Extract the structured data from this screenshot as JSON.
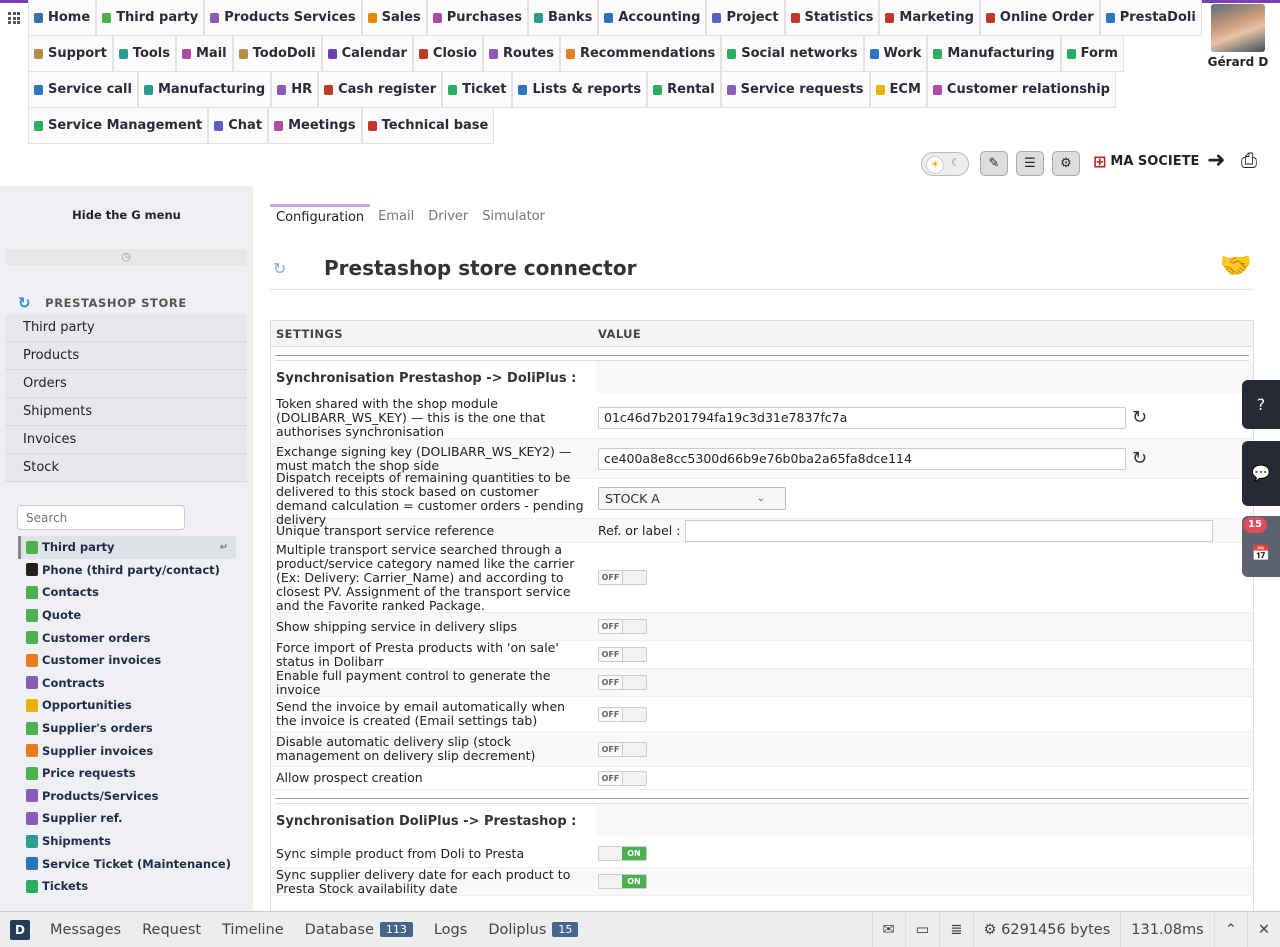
{
  "menu": {
    "rows": [
      [
        {
          "label": "Home",
          "icon": "home-icon",
          "color": "#3a6ea5"
        },
        {
          "label": "Third party",
          "icon": "building-icon",
          "color": "#4caf50"
        },
        {
          "label": "Products Services",
          "icon": "cubes-icon",
          "color": "#8a5cb8"
        },
        {
          "label": "Sales",
          "icon": "euro-icon",
          "color": "#e68a00"
        },
        {
          "label": "Purchases",
          "icon": "cart-icon",
          "color": "#b04ca8"
        },
        {
          "label": "Banks",
          "icon": "bank-icon",
          "color": "#2a9d8f"
        },
        {
          "label": "Accounting",
          "icon": "scale-icon",
          "color": "#2a75bb"
        },
        {
          "label": "Project",
          "icon": "sitemap-icon",
          "color": "#5b5fc7"
        },
        {
          "label": "Statistics",
          "icon": "chart-icon",
          "color": "#c0392b"
        },
        {
          "label": "Marketing",
          "icon": "megaphone-icon",
          "color": "#c0392b"
        },
        {
          "label": "Online Order",
          "icon": "globe-icon",
          "color": "#c0392b"
        },
        {
          "label": "PrestaDoli",
          "icon": "sync-icon",
          "color": "#2a75bb"
        }
      ],
      [
        {
          "label": "Support",
          "icon": "briefcase-icon",
          "color": "#b98b4a"
        },
        {
          "label": "Tools",
          "icon": "tools-icon",
          "color": "#2a9d8f"
        },
        {
          "label": "Mail",
          "icon": "mail-icon",
          "color": "#b04ca8"
        },
        {
          "label": "TodoDoli",
          "icon": "todo-icon",
          "color": "#b98b4a"
        },
        {
          "label": "Calendar",
          "icon": "calendar-icon",
          "color": "#6c3fb5"
        },
        {
          "label": "Closio",
          "icon": "closio-icon",
          "color": "#c0392b"
        },
        {
          "label": "Routes",
          "icon": "route-icon",
          "color": "#8a5cb8"
        },
        {
          "label": "Recommendations",
          "icon": "megaphone-icon",
          "color": "#e67e22"
        },
        {
          "label": "Social networks",
          "icon": "antenna-icon",
          "color": "#27ae60"
        },
        {
          "label": "Work",
          "icon": "road-icon",
          "color": "#2a75bb"
        },
        {
          "label": "Manufacturing",
          "icon": "chart-icon",
          "color": "#27ae60"
        },
        {
          "label": "Form",
          "icon": "form-icon",
          "color": "#27ae60"
        }
      ],
      [
        {
          "label": "Service call",
          "icon": "pen-icon",
          "color": "#2a75bb"
        },
        {
          "label": "Manufacturing",
          "icon": "cylinder-icon",
          "color": "#2a9d8f"
        },
        {
          "label": "HR",
          "icon": "users-icon",
          "color": "#8a5cb8"
        },
        {
          "label": "Cash register",
          "icon": "register-icon",
          "color": "#c0392b"
        },
        {
          "label": "Ticket",
          "icon": "headset-icon",
          "color": "#27ae60"
        },
        {
          "label": "Lists & reports",
          "icon": "table-icon",
          "color": "#2a75bb"
        },
        {
          "label": "Rental",
          "icon": "truck-icon",
          "color": "#27ae60"
        },
        {
          "label": "Service requests",
          "icon": "file-icon",
          "color": "#8a5cb8"
        },
        {
          "label": "ECM",
          "icon": "folder-icon",
          "color": "#e6b400"
        },
        {
          "label": "Customer relationship",
          "icon": "handshake-icon",
          "color": "#b04ca8"
        }
      ],
      [
        {
          "label": "Service Management",
          "icon": "handshake-icon",
          "color": "#27ae60"
        },
        {
          "label": "Chat",
          "icon": "chat-icon",
          "color": "#5b5fc7"
        },
        {
          "label": "Meetings",
          "icon": "video-icon",
          "color": "#b04ca8"
        },
        {
          "label": "Technical base",
          "icon": "book-icon",
          "color": "#c0392b"
        }
      ]
    ]
  },
  "user": {
    "name": "Gérard D"
  },
  "toolbar": {
    "company": "MA SOCIETE"
  },
  "left": {
    "hide_g_menu": "Hide the G menu",
    "loader": "◷",
    "ps_title": "PRESTASHOP STORE",
    "ps_items": [
      "Third party",
      "Products",
      "Orders",
      "Shipments",
      "Invoices",
      "Stock"
    ],
    "search_placeholder": "Search",
    "g_items": [
      {
        "label": "Third party",
        "icon": "building-icon",
        "color": "#4caf50",
        "active": true
      },
      {
        "label": "Phone (third party/contact)",
        "icon": "phone-icon",
        "color": "#222"
      },
      {
        "label": "Contacts",
        "icon": "users-icon",
        "color": "#4caf50"
      },
      {
        "label": "Quote",
        "icon": "quote-icon",
        "color": "#4caf50"
      },
      {
        "label": "Customer orders",
        "icon": "order-icon",
        "color": "#4caf50"
      },
      {
        "label": "Customer invoices",
        "icon": "euro-icon",
        "color": "#e67e22"
      },
      {
        "label": "Contracts",
        "icon": "contract-icon",
        "color": "#8a5cb8"
      },
      {
        "label": "Opportunities",
        "icon": "opportunity-icon",
        "color": "#e6b400"
      },
      {
        "label": "Supplier's orders",
        "icon": "order-icon",
        "color": "#4caf50"
      },
      {
        "label": "Supplier invoices",
        "icon": "euro-icon",
        "color": "#e67e22"
      },
      {
        "label": "Price requests",
        "icon": "quote-icon",
        "color": "#4caf50"
      },
      {
        "label": "Products/Services",
        "icon": "cubes-icon",
        "color": "#8a5cb8"
      },
      {
        "label": "Supplier ref.",
        "icon": "cubes-icon",
        "color": "#8a5cb8"
      },
      {
        "label": "Shipments",
        "icon": "truck-icon",
        "color": "#2a9d8f"
      },
      {
        "label": "Service Ticket (Maintenance)",
        "icon": "pen-icon",
        "color": "#2a75bb"
      },
      {
        "label": "Tickets",
        "icon": "headset-icon",
        "color": "#27ae60"
      }
    ]
  },
  "content": {
    "tabs": [
      "Configuration",
      "Email",
      "Driver",
      "Simulator"
    ],
    "title": "Prestashop store connector",
    "table_headers": {
      "settings": "SETTINGS",
      "value": "VALUE"
    },
    "section1": "Synchronisation Prestashop -> DoliPlus :",
    "section2": "Synchronisation DoliPlus -> Prestashop :",
    "rows": [
      {
        "label": "Token shared with the shop module (DOLIBARR_WS_KEY) — this is the one that authorises synchronisation",
        "type": "text",
        "value": "01c46d7b201794fa19c3d31e7837fc7a"
      },
      {
        "label": "Exchange signing key (DOLIBARR_WS_KEY2) — must match the shop side",
        "type": "text",
        "value": "ce400a8e8cc5300d66b9e76b0ba2a65fa8dce114"
      },
      {
        "label": "Dispatch receipts of remaining quantities to be delivered to this stock based on customer demand calculation = customer orders - pending delivery",
        "type": "select",
        "value": "STOCK A"
      },
      {
        "label": "Unique transport service reference",
        "type": "ref",
        "prefix": "Ref. or label :"
      },
      {
        "label": "Multiple transport service searched through a product/service category named like the carrier (Ex: Delivery: Carrier_Name) and according to closest PV. Assignment of the transport service and the Favorite ranked Package.",
        "type": "switch",
        "state": "OFF"
      },
      {
        "label": "Show shipping service in delivery slips",
        "type": "switch",
        "state": "OFF"
      },
      {
        "label": "Force import of Presta products with 'on sale' status in Dolibarr",
        "type": "switch",
        "state": "OFF"
      },
      {
        "label": "Enable full payment control to generate the invoice",
        "type": "switch",
        "state": "OFF"
      },
      {
        "label": "Send the invoice by email automatically when the invoice is created (Email settings tab)",
        "type": "switch",
        "state": "OFF"
      },
      {
        "label": "Disable automatic delivery slip (stock management on delivery slip decrement)",
        "type": "switch",
        "state": "OFF"
      },
      {
        "label": "Allow prospect creation",
        "type": "switch",
        "state": "OFF"
      }
    ],
    "rows2": [
      {
        "label": "Sync simple product from Doli to Presta",
        "type": "switch",
        "state": "ON"
      },
      {
        "label": "Sync supplier delivery date for each product to Presta Stock availability date",
        "type": "switch",
        "state": "ON"
      }
    ]
  },
  "side": {
    "badge": "15"
  },
  "debugbar": {
    "logo": "D",
    "tabs": [
      {
        "label": "Messages"
      },
      {
        "label": "Request"
      },
      {
        "label": "Timeline"
      },
      {
        "label": "Database",
        "badge": "113"
      },
      {
        "label": "Logs"
      },
      {
        "label": "Doliplus",
        "badge": "15"
      }
    ],
    "memory": "6291456 bytes",
    "time": "131.08ms"
  }
}
